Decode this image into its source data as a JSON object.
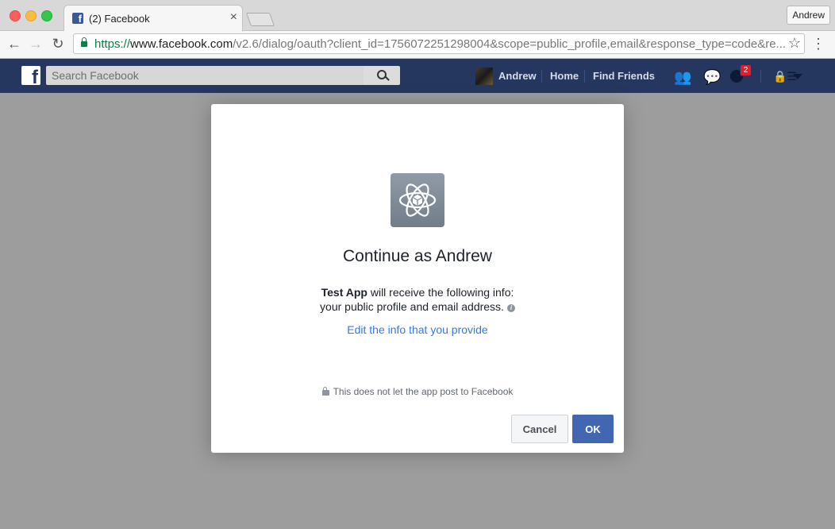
{
  "browser": {
    "tab_title": "(2) Facebook",
    "tab_close": "×",
    "profile_name": "Andrew",
    "url_scheme": "https://",
    "url_host": "www.facebook.com",
    "url_rest": "/v2.6/dialog/oauth?client_id=1756072251298004&scope=public_profile,email&response_type=code&re...",
    "back_icon": "←",
    "forward_icon": "→",
    "reload_icon": "↻",
    "star_icon": "☆",
    "menu_icon": "⋮"
  },
  "fbbar": {
    "logo": "f",
    "search_placeholder": "Search Facebook",
    "user_name": "Andrew",
    "home_label": "Home",
    "find_friends_label": "Find Friends",
    "notification_count": "2",
    "friend_requests_icon": "👥",
    "messages_icon": "💬",
    "privacy_icon": "🔒☰"
  },
  "dialog": {
    "title": "Continue as Andrew",
    "app_name": "Test App",
    "info_line1_rest": " will receive the following info:",
    "info_line2": "your public profile and email address.",
    "info_icon": "i",
    "edit_link": "Edit the info that you provide",
    "notice": "This does not let the app post to Facebook",
    "cancel_label": "Cancel",
    "ok_label": "OK"
  },
  "colors": {
    "fb_bar": "#25375e",
    "fb_blue": "#4267b2",
    "link_blue": "#3578e5",
    "overlay": "#9d9d9d"
  }
}
